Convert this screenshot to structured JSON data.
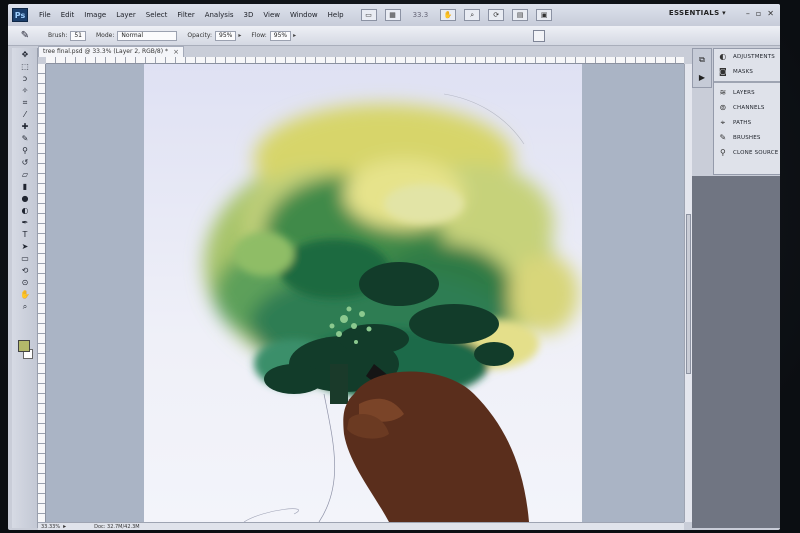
{
  "menubar": {
    "logo": "Ps",
    "items": [
      "File",
      "Edit",
      "Image",
      "Layer",
      "Select",
      "Filter",
      "Analysis",
      "3D",
      "View",
      "Window",
      "Help"
    ],
    "zoom_value": "33.3",
    "workspace": "ESSENTIALS",
    "workspace_arrow": "▾",
    "window_controls": [
      "–",
      "▫",
      "✕"
    ]
  },
  "options": {
    "brush_label": "Brush:",
    "brush_size": "51",
    "mode_label": "Mode:",
    "mode_value": "Normal",
    "opacity_label": "Opacity:",
    "opacity_value": "95%",
    "flow_label": "Flow:",
    "flow_value": "95%"
  },
  "document": {
    "tab_title": "tree final.psd @ 33.3% (Layer 2, RGB/8) *",
    "tab_close": "×",
    "status_zoom": "33.33%",
    "status_doc": "Doc: 32.7M/42.3M"
  },
  "panels": {
    "group1": [
      "ADJUSTMENTS",
      "MASKS"
    ],
    "group2": [
      "LAYERS",
      "CHANNELS",
      "PATHS",
      "BRUSHES",
      "CLONE SOURCE"
    ]
  },
  "colors": {
    "foreground": "#b3b86a",
    "background": "#ffffff"
  },
  "icons": {
    "tools": [
      "move-icon",
      "marquee-icon",
      "lasso-icon",
      "quick-select-icon",
      "crop-icon",
      "eyedropper-icon",
      "healing-icon",
      "brush-icon",
      "clone-stamp-icon",
      "history-brush-icon",
      "eraser-icon",
      "gradient-icon",
      "blur-icon",
      "dodge-icon",
      "pen-icon",
      "type-icon",
      "path-select-icon",
      "shape-icon",
      "3d-rotate-icon",
      "3d-orbit-icon",
      "hand-icon",
      "zoom-icon"
    ]
  }
}
